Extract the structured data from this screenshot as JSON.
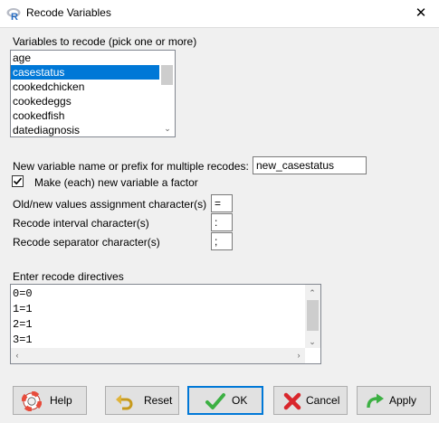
{
  "window": {
    "title": "Recode Variables"
  },
  "variables": {
    "label": "Variables to recode (pick one or more)",
    "items": [
      "age",
      "casestatus",
      "cookedchicken",
      "cookedeggs",
      "cookedfish",
      "datediagnosis"
    ],
    "selected": "casestatus"
  },
  "new_name": {
    "label": "New variable name or prefix for multiple recodes:",
    "value": "new_casestatus"
  },
  "make_factor": {
    "label": "Make (each) new variable a factor",
    "checked": true
  },
  "assign_char": {
    "label": "Old/new values assignment character(s)",
    "value": "="
  },
  "interval_char": {
    "label": "Recode interval character(s)",
    "value": ":"
  },
  "separator_char": {
    "label": "Recode separator character(s)",
    "value": ";"
  },
  "directives": {
    "label": "Enter recode directives",
    "lines": [
      "0=0",
      "1=1",
      "2=1",
      "3=1"
    ]
  },
  "buttons": {
    "help": "Help",
    "reset": "Reset",
    "ok": "OK",
    "cancel": "Cancel",
    "apply": "Apply"
  },
  "icons": {
    "app": "r-logo-icon",
    "close": "close-icon",
    "check": "checkmark-icon",
    "help": "lifebuoy-icon",
    "reset": "undo-arrow-icon",
    "ok": "green-check-icon",
    "cancel": "red-x-icon",
    "apply": "green-arrow-icon"
  },
  "colors": {
    "selection": "#0078d7",
    "ok_green": "#3cb043",
    "cancel_red": "#d9262c"
  }
}
